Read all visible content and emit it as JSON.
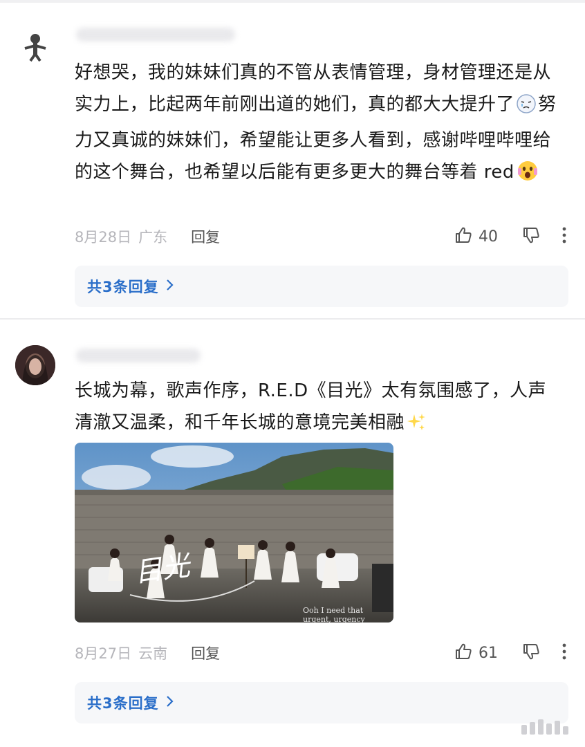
{
  "comments": [
    {
      "text_1": "好想哭，我的妹妹们真的不管从表情管理，身材管理还是从实力上，比起两年前刚出道的她们，真的都大大提升了",
      "text_2": "努力又真诚的妹妹们，希望能让更多人看到，感谢哔哩哔哩给的这个舞台，也希望以后能有更多更大的舞台等着 red",
      "date": "8月28日",
      "region": "广东",
      "reply_label": "回复",
      "likes": "40",
      "replies_label": "共3条回复"
    },
    {
      "text": "长城为幕，歌声作序，R.E.D《目光》太有氛围感了，人声清澈又温柔，和千年长城的意境完美相融",
      "photo_title": "目光",
      "photo_caption": "Ooh I need that urgent, urgency",
      "date": "8月27日",
      "region": "云南",
      "reply_label": "回复",
      "likes": "61",
      "replies_label": "共3条回复"
    }
  ],
  "colors": {
    "link_blue": "#2a6ec9",
    "muted": "#b5b5ba",
    "reply_bg": "#f6f7f9"
  },
  "icons": [
    "thumbs-up-icon",
    "thumbs-down-icon",
    "more-vertical-icon",
    "chevron-right-icon",
    "crying-emoji-icon",
    "shocked-emoji-icon",
    "sparkles-emoji-icon"
  ]
}
